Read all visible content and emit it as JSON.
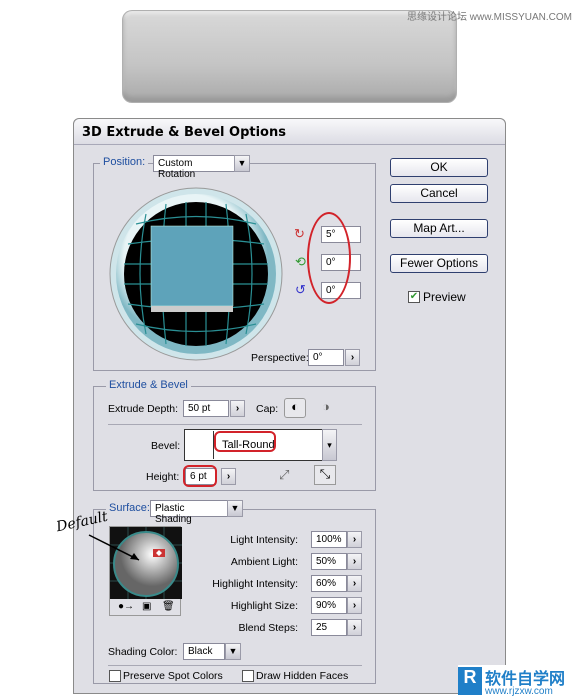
{
  "watermark_top": "思缘设计论坛 www.MISSYUAN.COM",
  "watermark_bottom": {
    "brand": "软件自学网",
    "url": "www.rjzxw.com"
  },
  "dialog": {
    "title": "3D Extrude & Bevel Options"
  },
  "buttons": {
    "ok": "OK",
    "cancel": "Cancel",
    "map_art": "Map Art...",
    "fewer_options": "Fewer Options"
  },
  "preview": {
    "label": "Preview",
    "checked": true
  },
  "position": {
    "label": "Position:",
    "value": "Custom Rotation",
    "x_rotation": "5°",
    "y_rotation": "0°",
    "z_rotation": "0°",
    "perspective_label": "Perspective:",
    "perspective": "0°"
  },
  "extrude": {
    "legend": "Extrude & Bevel",
    "depth_label": "Extrude Depth:",
    "depth": "50 pt",
    "cap_label": "Cap:",
    "bevel_label": "Bevel:",
    "bevel": "Tall-Round",
    "height_label": "Height:",
    "height": "6 pt"
  },
  "surface": {
    "label": "Surface:",
    "value": "Plastic Shading",
    "annotation": "Default",
    "properties": [
      {
        "label": "Light Intensity:",
        "value": "100%"
      },
      {
        "label": "Ambient Light:",
        "value": "50%"
      },
      {
        "label": "Highlight Intensity:",
        "value": "60%"
      },
      {
        "label": "Highlight Size:",
        "value": "90%"
      },
      {
        "label": "Blend Steps:",
        "value": "25"
      }
    ],
    "shading_color_label": "Shading Color:",
    "shading_color": "Black",
    "preserve_spot": "Preserve Spot Colors",
    "draw_hidden": "Draw Hidden Faces"
  },
  "colors": {
    "accent": "#d2232a",
    "legend": "#1f4fa0",
    "face": "#5ea3ba"
  }
}
